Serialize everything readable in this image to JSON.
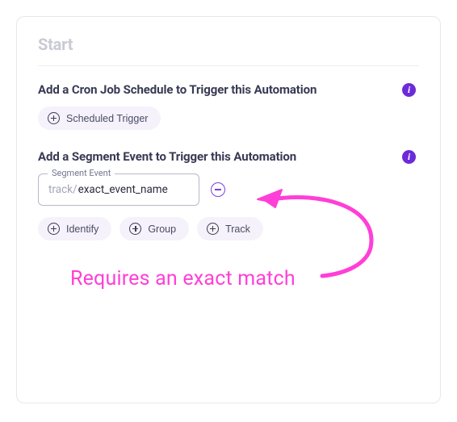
{
  "card": {
    "title": "Start"
  },
  "cron_section": {
    "title": "Add a Cron Job Schedule to Trigger this Automation",
    "buttons": {
      "scheduled": "Scheduled Trigger"
    }
  },
  "segment_section": {
    "title": "Add a Segment Event to Trigger this Automation",
    "field": {
      "label": "Segment Event",
      "prefix": "track/",
      "value": "exact_event_name"
    },
    "buttons": {
      "identify": "Identify",
      "group": "Group",
      "track": "Track"
    }
  },
  "annotation": {
    "text": "Requires an exact match"
  },
  "icons": {
    "info_glyph": "i"
  },
  "colors": {
    "info_bg": "#6c2bd9",
    "annotation": "#ff3fd7",
    "pill_bg": "#f6f2fb",
    "accent": "#7a3fe0"
  }
}
